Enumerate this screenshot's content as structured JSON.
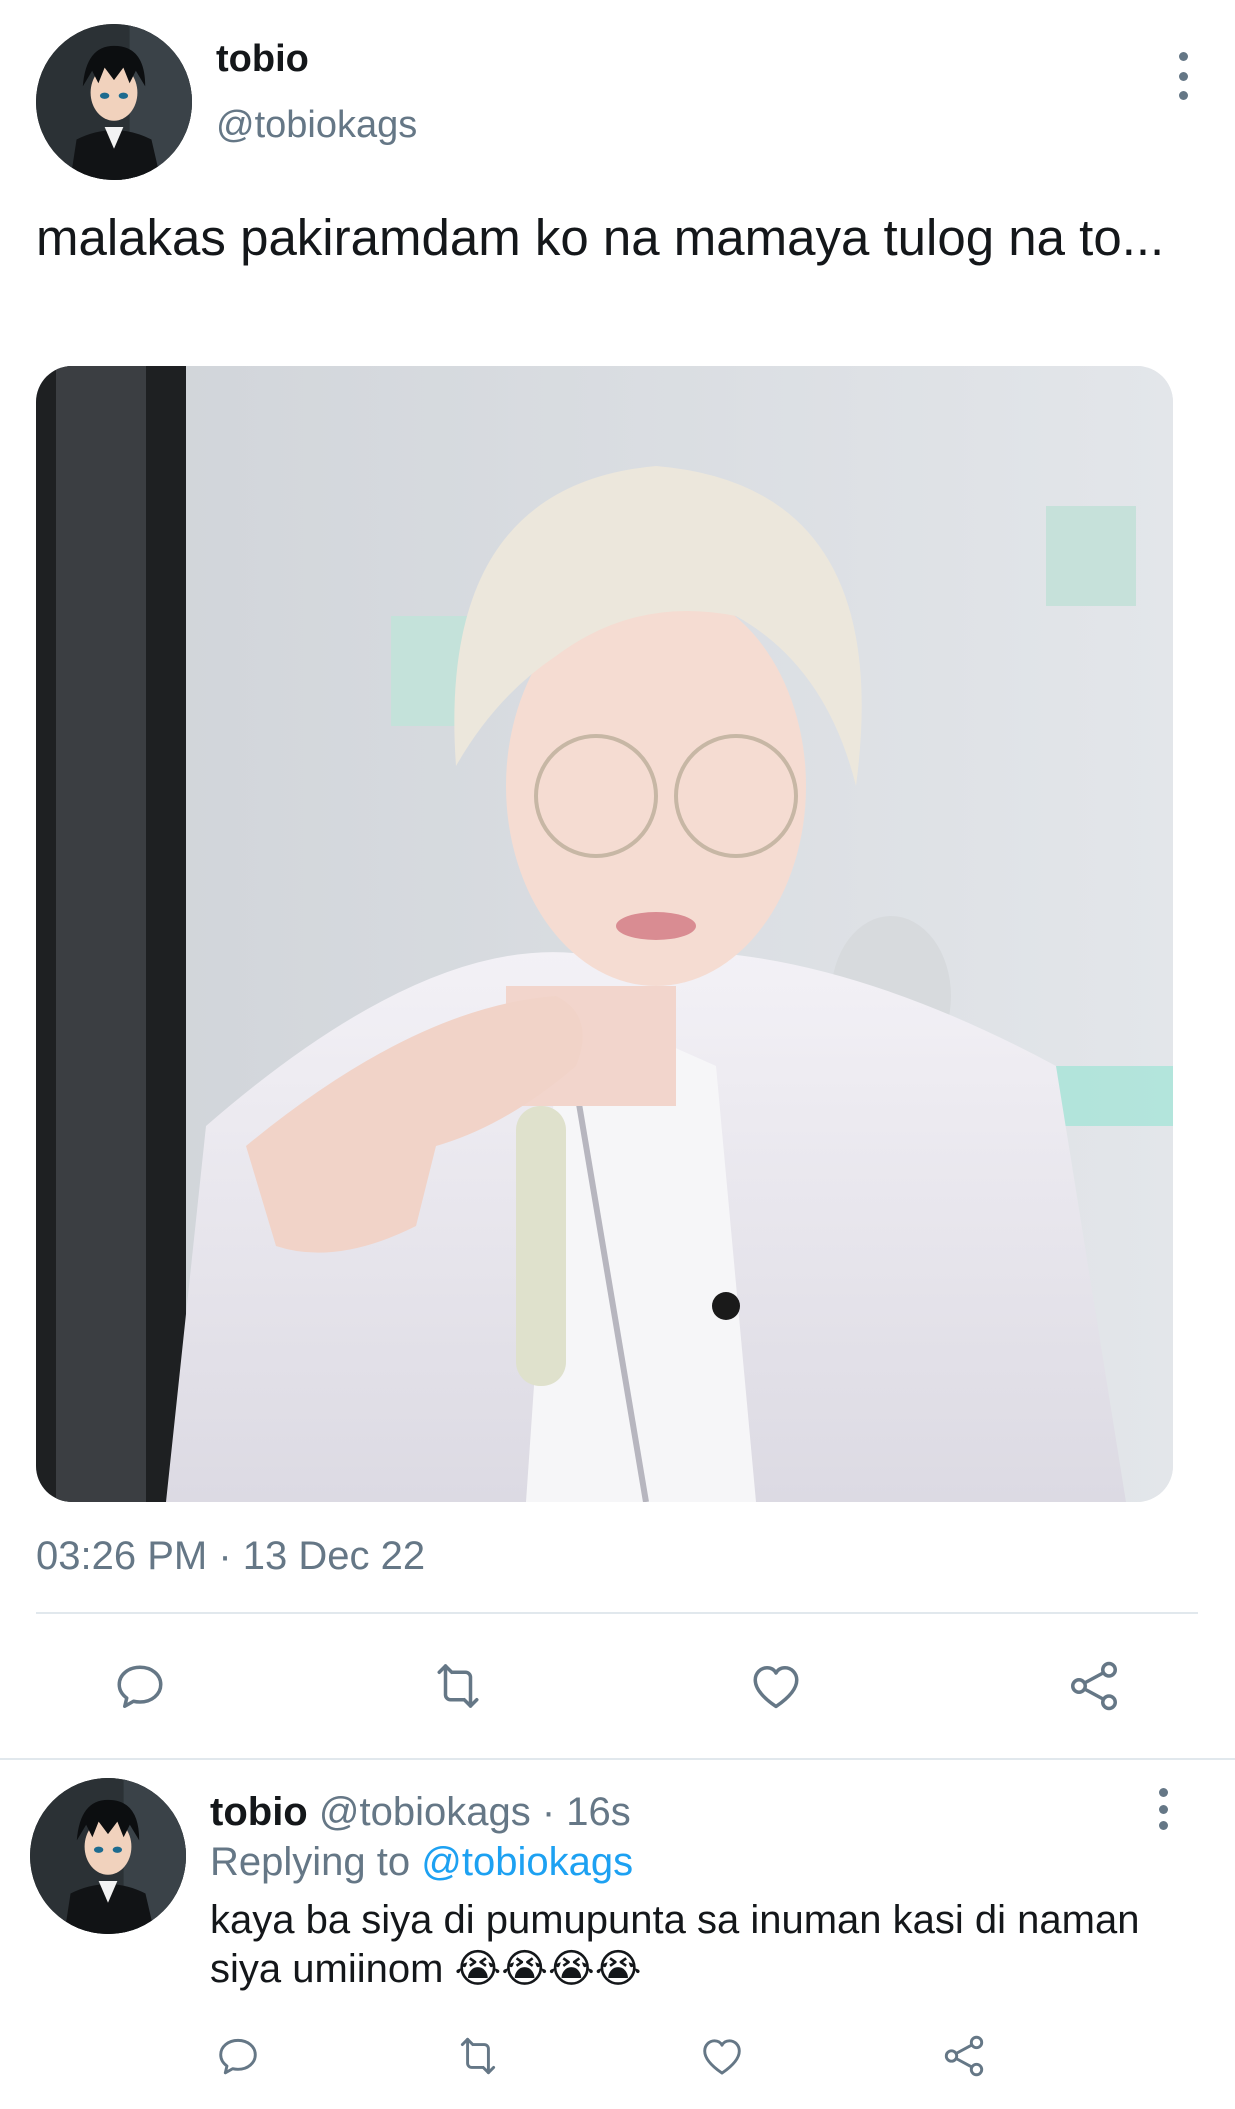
{
  "tweet": {
    "author_name": "tobio",
    "author_handle": "@tobiokags",
    "text": "malakas pakiramdam ko na mamaya tulog na to...",
    "timestamp": "03:26 PM · 13 Dec 22",
    "icons": {
      "avatar": "anime-avatar-image",
      "more": "more-vertical-icon",
      "reply": "reply-icon",
      "retweet": "retweet-icon",
      "like": "heart-icon",
      "share": "share-icon"
    }
  },
  "reply": {
    "author_name": "tobio",
    "author_handle": "@tobiokags",
    "separator": "·",
    "time_ago": "16s",
    "replying_prefix": "Replying to",
    "replying_to": "@tobiokags",
    "text": "kaya ba siya di pumupunta sa inuman kasi di naman siya umiinom 😭😭😭😭"
  },
  "colors": {
    "text": "#14171a",
    "secondary": "#657786",
    "accent": "#1da1f2",
    "divider": "#e1e8ed"
  }
}
